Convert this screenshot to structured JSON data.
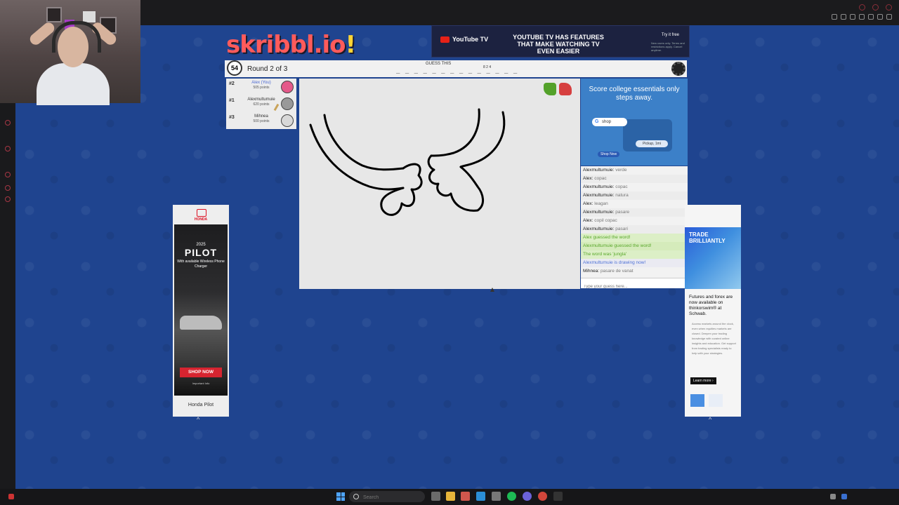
{
  "game": {
    "logo": "skribbl.io",
    "logo_mark": "!",
    "round_timer": "54",
    "round_label": "Round 2 of 3",
    "guess_label": "GUESS THIS",
    "hint": "_ _ _ _ _ _ _ _   _ _   _ _ _ _",
    "hint_lengths": "8 2 4"
  },
  "players": [
    {
      "rank": "#2",
      "name": "Alex (You)",
      "points": "505 points",
      "is_you": true
    },
    {
      "rank": "#1",
      "name": "Alexmultumuie",
      "points": "620 points",
      "is_you": false
    },
    {
      "rank": "#3",
      "name": "Mihnea",
      "points": "500 points",
      "is_you": false
    }
  ],
  "chat": [
    {
      "author": "Alexmultumuie:",
      "text": "verde",
      "kind": "normal"
    },
    {
      "author": "Alex:",
      "text": "copac",
      "kind": "normal"
    },
    {
      "author": "Alexmultumuie:",
      "text": "copac",
      "kind": "normal"
    },
    {
      "author": "Alexmultumuie:",
      "text": "natura",
      "kind": "normal"
    },
    {
      "author": "Alex:",
      "text": "leagan",
      "kind": "normal"
    },
    {
      "author": "Alexmultumuie:",
      "text": "pasare",
      "kind": "normal"
    },
    {
      "author": "Alex:",
      "text": "copil copac",
      "kind": "normal"
    },
    {
      "author": "Alexmultumuie:",
      "text": "pasari",
      "kind": "normal"
    },
    {
      "author": "",
      "text": "Alex guessed the word!",
      "kind": "green"
    },
    {
      "author": "",
      "text": "Alexmultumuie guessed the word!",
      "kind": "green"
    },
    {
      "author": "",
      "text": "The word was 'jungla'",
      "kind": "green"
    },
    {
      "author": "",
      "text": "Alexmultumuie is drawing now!",
      "kind": "blue"
    },
    {
      "author": "Mihnea:",
      "text": "pasare de vanat",
      "kind": "normal"
    }
  ],
  "chat_input": {
    "placeholder": "Type your guess here..."
  },
  "ad_top": {
    "brand": "YouTube TV",
    "headline": "YOUTUBE TV HAS FEATURES THAT MAKE WATCHING TV EVEN EASIER",
    "cta": "Try it free",
    "fine_print": "New users only. Terms and restrictions apply. Cancel anytime."
  },
  "ad_side": {
    "title": "Score college essentials only steps away.",
    "search_chip": "shop",
    "pickup_chip": "Pickup, 1mi",
    "cta": "Shop Now"
  },
  "ad_left": {
    "brand": "HONDA",
    "year": "2025",
    "model": "PILOT",
    "feature": "With available Wireless Phone Charger",
    "cta": "SHOP NOW",
    "important": "Important Info",
    "caption": "Honda Pilot"
  },
  "ad_right": {
    "headline": "TRADE BRILLIANTLY",
    "subhead": "Futures and forex are now available on thinkorswim® at Schwab.",
    "bullets": "Access markets around the clock, even when equities markets are closed. Deepen your trading knowledge with curated online insights and education. Get support from trading specialists ready to help with your strategies.",
    "cta": "Learn more ›"
  },
  "taskbar": {
    "search_placeholder": "Search"
  },
  "colors": {
    "page_bg": "#1f448f",
    "canvas_bg": "#e7e7e7",
    "guess_green": "#59a82b",
    "drawing_blue": "#4f72d6",
    "accent_red": "#d62430"
  }
}
